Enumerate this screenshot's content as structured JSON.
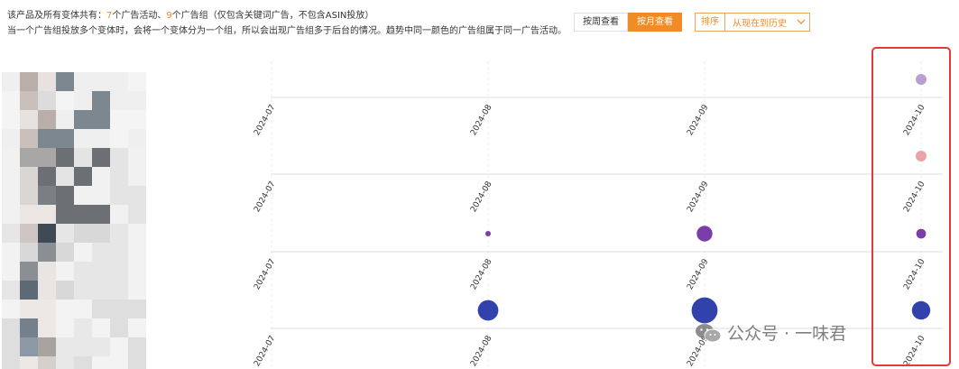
{
  "info": {
    "line1_prefix": "该产品及所有变体共有：",
    "campaign_count": "7",
    "campaign_text": "个广告活动、",
    "group_count": "9",
    "group_text": "个广告组（仅包含关键词广告，不包含ASIN投放）",
    "line2": "当一个广告组投放多个变体时，会将一个变体分为一个组，所以会出现广告组多于后台的情况。趋势中同一颜色的广告组属于同一广告活动。"
  },
  "toolbar": {
    "week_button": "按周查看",
    "month_button": "按月查看",
    "active_view": "month",
    "sort_label": "排序",
    "sort_value": "从现在到历史"
  },
  "colors": {
    "accent": "#f08c26",
    "highlight": "#e53935"
  },
  "watermark": {
    "text": "公众号 · 一味君",
    "icon": "wechat-icon"
  },
  "chart_data": {
    "type": "scatter",
    "x": [
      "2024-07",
      "2024-08",
      "2024-09",
      "2024-10"
    ],
    "rows": [
      {
        "points": [
          {
            "x": "2024-10",
            "size": 1.0,
            "color": "#b9a0d2"
          }
        ]
      },
      {
        "points": [
          {
            "x": "2024-10",
            "size": 1.0,
            "color": "#eba3aa"
          }
        ]
      },
      {
        "points": [
          {
            "x": "2024-08",
            "size": 0.5,
            "color": "#7b3ea8"
          },
          {
            "x": "2024-09",
            "size": 1.45,
            "color": "#7b3ea8"
          },
          {
            "x": "2024-10",
            "size": 0.9,
            "color": "#7b3ea8"
          }
        ]
      },
      {
        "points": [
          {
            "x": "2024-08",
            "size": 1.9,
            "color": "#3142ad"
          },
          {
            "x": "2024-09",
            "size": 2.4,
            "color": "#3142ad"
          },
          {
            "x": "2024-10",
            "size": 1.7,
            "color": "#3142ad"
          }
        ]
      }
    ]
  }
}
